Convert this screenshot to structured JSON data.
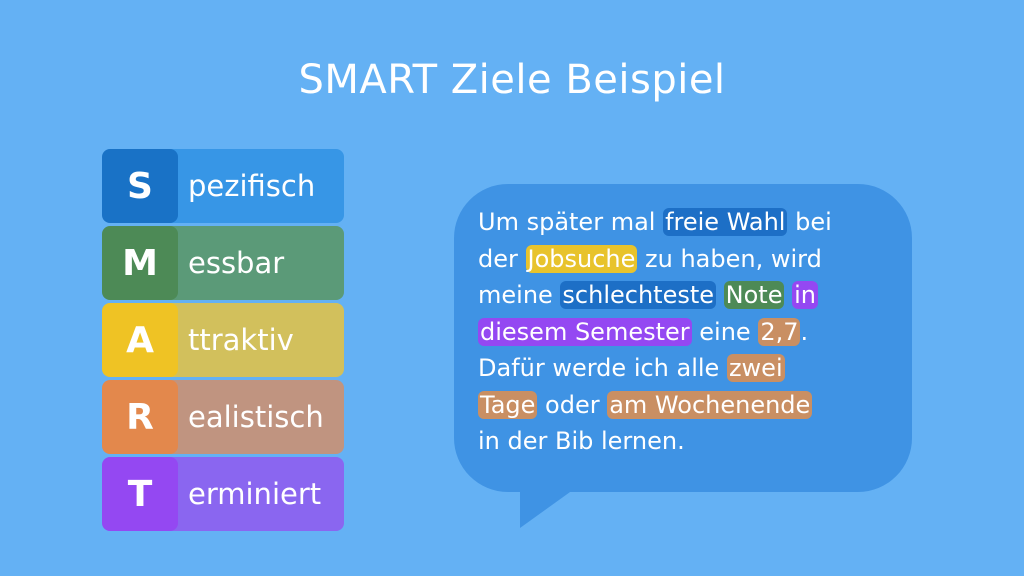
{
  "title": "SMART Ziele Beispiel",
  "smart": [
    {
      "letter": "S",
      "rest": "pezifisch",
      "letter_color": "#1972c6",
      "bar_color": "#3796e6"
    },
    {
      "letter": "M",
      "rest": "essbar",
      "letter_color": "#4d8a56",
      "bar_color": "#5b9a78"
    },
    {
      "letter": "A",
      "rest": "ttraktiv",
      "letter_color": "#efc324",
      "bar_color": "#d2c05c"
    },
    {
      "letter": "R",
      "rest": "ealistisch",
      "letter_color": "#e3884c",
      "bar_color": "#c09480"
    },
    {
      "letter": "T",
      "rest": "erminiert",
      "letter_color": "#9448f2",
      "bar_color": "#8a66f0"
    }
  ],
  "bubble": {
    "background": "#3f93e4",
    "lines": [
      [
        {
          "text": "Um später mal "
        },
        {
          "text": "freie Wahl",
          "hl": "#1d6fc6"
        },
        {
          "text": " bei"
        }
      ],
      [
        {
          "text": "der "
        },
        {
          "text": "Jobsuche",
          "hl": "#e8c32c"
        },
        {
          "text": " zu haben, wird"
        }
      ],
      [
        {
          "text": "meine "
        },
        {
          "text": "schlechteste",
          "hl": "#1d6fc6"
        },
        {
          "text": " "
        },
        {
          "text": "Note",
          "hl": "#4d8a56"
        },
        {
          "text": " "
        },
        {
          "text": "in",
          "hl": "#9448f2"
        }
      ],
      [
        {
          "text": "diesem Semester",
          "hl": "#9448f2"
        },
        {
          "text": " eine "
        },
        {
          "text": "2,7",
          "hl": "#c98f63"
        },
        {
          "text": "."
        }
      ],
      [
        {
          "text": "Dafür werde ich alle "
        },
        {
          "text": "zwei",
          "hl": "#c98f63"
        }
      ],
      [
        {
          "text": "Tage",
          "hl": "#c98f63"
        },
        {
          "text": " oder "
        },
        {
          "text": "am Wochenende",
          "hl": "#c98f63"
        }
      ],
      [
        {
          "text": "in der Bib lernen."
        }
      ]
    ]
  }
}
